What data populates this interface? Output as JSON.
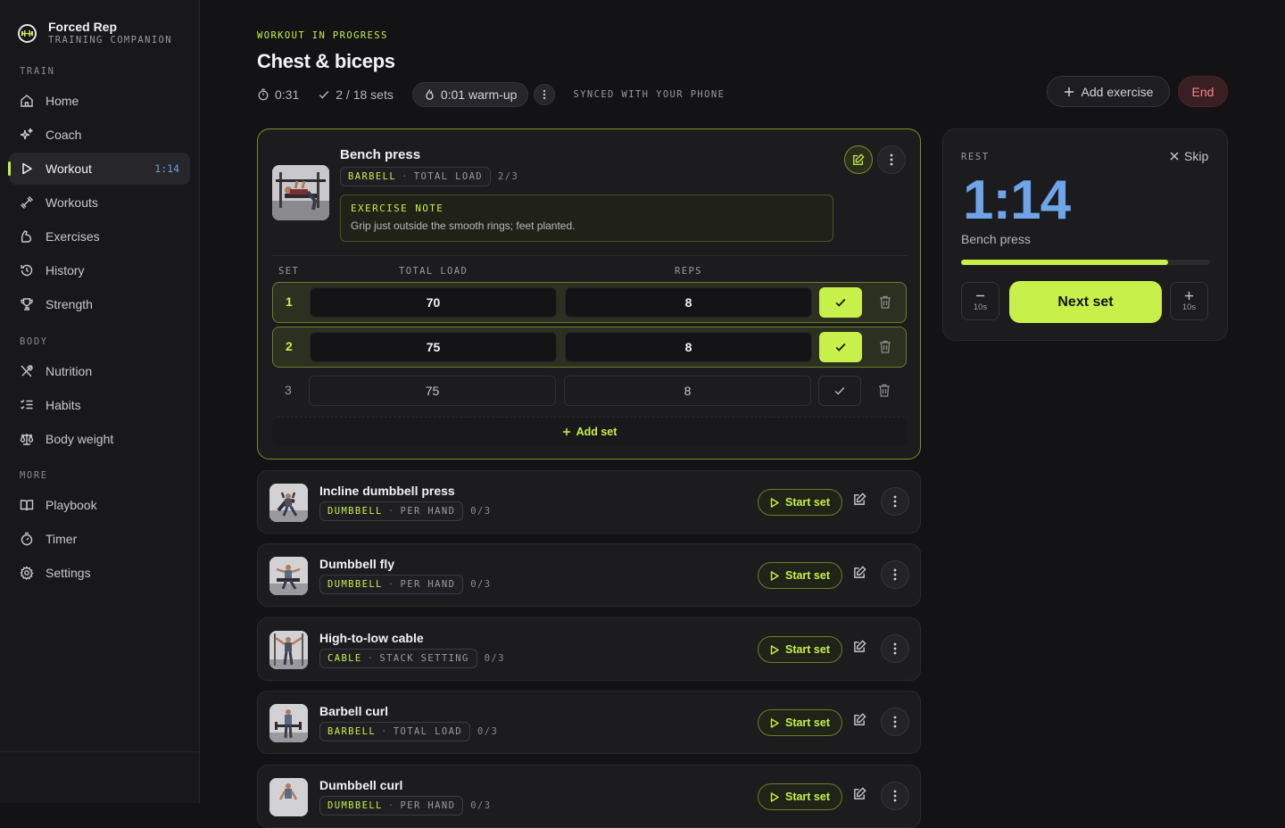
{
  "brand": {
    "name": "Forced Rep",
    "subtitle": "TRAINING COMPANION"
  },
  "sidebar": {
    "sections": [
      {
        "label": "TRAIN",
        "items": [
          {
            "label": "Home",
            "icon": "home-icon"
          },
          {
            "label": "Coach",
            "icon": "sparkles-icon"
          },
          {
            "label": "Workout",
            "icon": "play-icon",
            "active": true,
            "badge": "1:14"
          },
          {
            "label": "Workouts",
            "icon": "dumbbell-icon"
          },
          {
            "label": "Exercises",
            "icon": "muscle-icon"
          },
          {
            "label": "History",
            "icon": "history-icon"
          },
          {
            "label": "Strength",
            "icon": "trophy-icon"
          }
        ]
      },
      {
        "label": "BODY",
        "items": [
          {
            "label": "Nutrition",
            "icon": "utensils-icon"
          },
          {
            "label": "Habits",
            "icon": "checklist-icon"
          },
          {
            "label": "Body weight",
            "icon": "scale-icon"
          }
        ]
      },
      {
        "label": "MORE",
        "items": [
          {
            "label": "Playbook",
            "icon": "book-icon"
          },
          {
            "label": "Timer",
            "icon": "timer-icon"
          },
          {
            "label": "Settings",
            "icon": "gear-icon"
          }
        ]
      }
    ]
  },
  "header": {
    "eyebrow": "WORKOUT IN PROGRESS",
    "title": "Chest & biceps",
    "elapsed": "0:31",
    "sets_progress": "2 / 18 sets",
    "warmup": "0:01 warm-up",
    "sync_status": "SYNCED WITH YOUR PHONE",
    "add_exercise": "Add exercise",
    "end": "End"
  },
  "active_exercise": {
    "name": "Bench press",
    "equipment": "BARBELL",
    "load_type": "TOTAL LOAD",
    "count": "2/3",
    "note_title": "EXERCISE NOTE",
    "note_text": "Grip just outside the smooth rings; feet planted.",
    "columns": {
      "set": "SET",
      "load": "TOTAL LOAD",
      "reps": "REPS"
    },
    "sets": [
      {
        "num": "1",
        "load": "70",
        "reps": "8",
        "done": true
      },
      {
        "num": "2",
        "load": "75",
        "reps": "8",
        "done": true
      },
      {
        "num": "3",
        "load": "75",
        "reps": "8",
        "done": false
      }
    ],
    "add_set": "Add set"
  },
  "queue": [
    {
      "name": "Incline dumbbell press",
      "equipment": "DUMBBELL",
      "load_type": "PER HAND",
      "count": "0/3"
    },
    {
      "name": "Dumbbell fly",
      "equipment": "DUMBBELL",
      "load_type": "PER HAND",
      "count": "0/3"
    },
    {
      "name": "High-to-low cable",
      "equipment": "CABLE",
      "load_type": "STACK SETTING",
      "count": "0/3"
    },
    {
      "name": "Barbell curl",
      "equipment": "BARBELL",
      "load_type": "TOTAL LOAD",
      "count": "0/3"
    },
    {
      "name": "Dumbbell curl",
      "equipment": "DUMBBELL",
      "load_type": "PER HAND",
      "count": "0/3"
    }
  ],
  "queue_action": "Start set",
  "rest": {
    "label": "REST",
    "skip": "Skip",
    "time": "1:14",
    "exercise": "Bench press",
    "progress": 0.83,
    "minus_label": "10s",
    "plus_label": "10s",
    "next": "Next set"
  },
  "colors": {
    "accent": "#c8f04a",
    "timer": "#6ea4e8",
    "danger": "#f08a8a",
    "background": "#131315"
  }
}
